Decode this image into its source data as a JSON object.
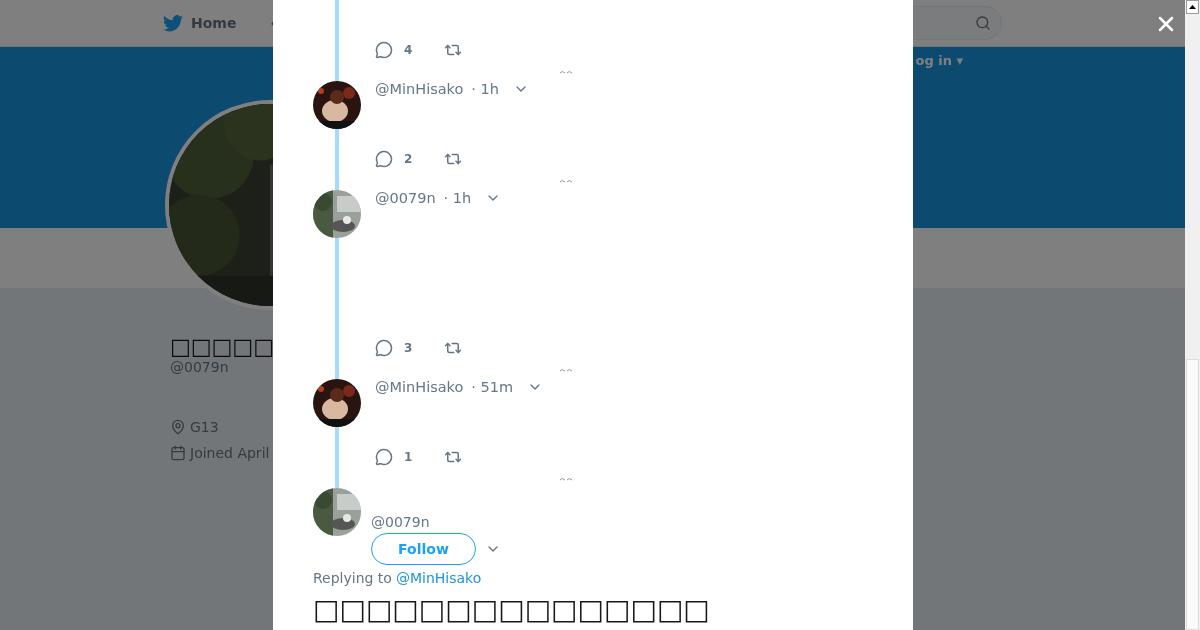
{
  "nav": {
    "home": "Home",
    "login": "og in ▾"
  },
  "profile": {
    "name": "□□□□□",
    "handle": "@0079n",
    "location": "G13",
    "joined": "Joined April"
  },
  "thread": [
    {
      "replies": "4"
    },
    {
      "handle": "@MinHisako",
      "time": "· 1h",
      "replies": "2"
    },
    {
      "handle": "@0079n",
      "time": "· 1h",
      "replies": "3"
    },
    {
      "handle": "@MinHisako",
      "time": "· 51m",
      "replies": "1"
    }
  ],
  "main_tweet": {
    "handle": "@0079n",
    "follow": "Follow",
    "replying_label": "Replying to",
    "replying_handle": "@MinHisako",
    "text_lines": [
      "□□□□□□□□□□□□□□□"
    ]
  }
}
